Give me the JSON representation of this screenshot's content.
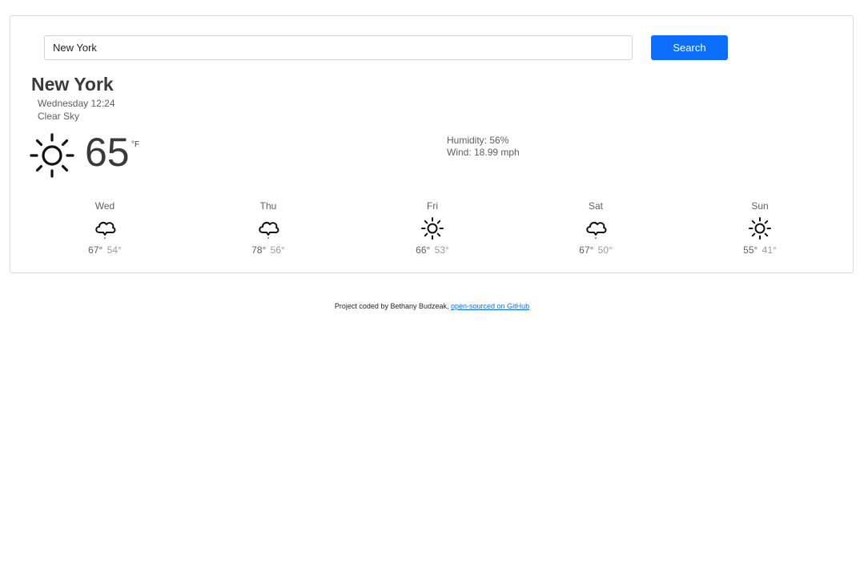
{
  "search": {
    "value": "New York",
    "button_label": "Search"
  },
  "current": {
    "city": "New York",
    "date": "Wednesday 12:24",
    "description": "Clear Sky",
    "temperature": "65",
    "unit": "°F",
    "icon": "sun-icon",
    "humidity": "Humidity: 56%",
    "wind": "Wind: 18.99 mph"
  },
  "forecast": [
    {
      "day": "Wed",
      "icon": "cloud-icon",
      "max": "67°",
      "min": "54°"
    },
    {
      "day": "Thu",
      "icon": "cloud-icon",
      "max": "78°",
      "min": "56°"
    },
    {
      "day": "Fri",
      "icon": "sun-icon",
      "max": "66°",
      "min": "53°"
    },
    {
      "day": "Sat",
      "icon": "cloud-icon",
      "max": "67°",
      "min": "50°"
    },
    {
      "day": "Sun",
      "icon": "sun-icon",
      "max": "55°",
      "min": "41°"
    }
  ],
  "footer": {
    "text": "Project coded by Bethany Budzeak,",
    "link_label": "open-sourced on GitHub"
  },
  "colors": {
    "accent": "#0d6efd",
    "border": "#dcdcdc"
  }
}
